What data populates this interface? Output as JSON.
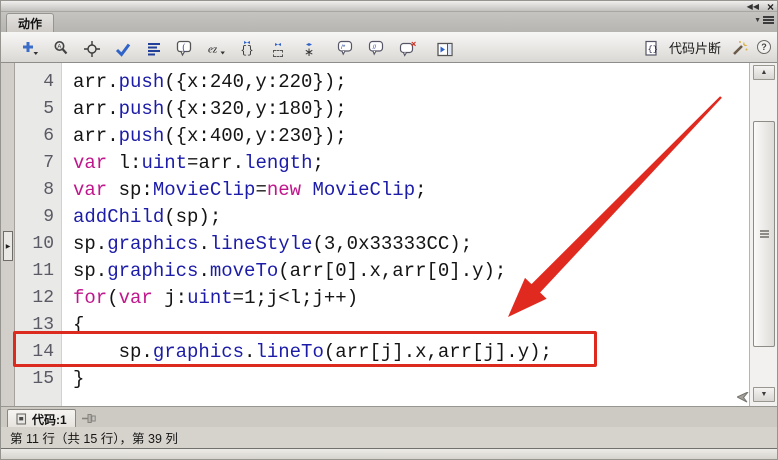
{
  "panel": {
    "title": "动作"
  },
  "toolbar": {
    "snippets_label": "代码片断",
    "icons": [
      "add-new-item",
      "find",
      "insert-target-path",
      "check-syntax",
      "auto-format",
      "show-code-hint",
      "debug-options",
      "collapse-between-braces",
      "collapse-selection",
      "expand-all",
      "apply-block-comment",
      "apply-line-comment",
      "remove-comment",
      "show-hide-toolbox",
      "code-snippets",
      "magic-wand",
      "help"
    ]
  },
  "code": {
    "colors": {
      "plain": "#141414",
      "method": "#1c1ca8",
      "keyword": "#c0168c"
    },
    "highlighted_line": 14,
    "lines": [
      {
        "num": 4,
        "segments": [
          {
            "t": "arr.",
            "c": "plain"
          },
          {
            "t": "push",
            "c": "method"
          },
          {
            "t": "({x:240,y:220});",
            "c": "plain"
          }
        ]
      },
      {
        "num": 5,
        "segments": [
          {
            "t": "arr.",
            "c": "plain"
          },
          {
            "t": "push",
            "c": "method"
          },
          {
            "t": "({x:320,y:180});",
            "c": "plain"
          }
        ]
      },
      {
        "num": 6,
        "segments": [
          {
            "t": "arr.",
            "c": "plain"
          },
          {
            "t": "push",
            "c": "method"
          },
          {
            "t": "({x:400,y:230});",
            "c": "plain"
          }
        ]
      },
      {
        "num": 7,
        "segments": [
          {
            "t": "var",
            "c": "keyword"
          },
          {
            "t": " l:",
            "c": "plain"
          },
          {
            "t": "uint",
            "c": "method"
          },
          {
            "t": "=arr.",
            "c": "plain"
          },
          {
            "t": "length",
            "c": "method"
          },
          {
            "t": ";",
            "c": "plain"
          }
        ]
      },
      {
        "num": 8,
        "segments": [
          {
            "t": "var",
            "c": "keyword"
          },
          {
            "t": " sp:",
            "c": "plain"
          },
          {
            "t": "MovieClip",
            "c": "method"
          },
          {
            "t": "=",
            "c": "plain"
          },
          {
            "t": "new",
            "c": "keyword"
          },
          {
            "t": " ",
            "c": "plain"
          },
          {
            "t": "MovieClip",
            "c": "method"
          },
          {
            "t": ";",
            "c": "plain"
          }
        ]
      },
      {
        "num": 9,
        "segments": [
          {
            "t": "addChild",
            "c": "method"
          },
          {
            "t": "(sp);",
            "c": "plain"
          }
        ]
      },
      {
        "num": 10,
        "segments": [
          {
            "t": "sp.",
            "c": "plain"
          },
          {
            "t": "graphics",
            "c": "method"
          },
          {
            "t": ".",
            "c": "plain"
          },
          {
            "t": "lineStyle",
            "c": "method"
          },
          {
            "t": "(3,0x33333CC);",
            "c": "plain"
          }
        ]
      },
      {
        "num": 11,
        "segments": [
          {
            "t": "sp.",
            "c": "plain"
          },
          {
            "t": "graphics",
            "c": "method"
          },
          {
            "t": ".",
            "c": "plain"
          },
          {
            "t": "moveTo",
            "c": "method"
          },
          {
            "t": "(arr[0].x,arr[0].y);",
            "c": "plain"
          }
        ]
      },
      {
        "num": 12,
        "segments": [
          {
            "t": "for",
            "c": "keyword"
          },
          {
            "t": "(",
            "c": "plain"
          },
          {
            "t": "var",
            "c": "keyword"
          },
          {
            "t": " j:",
            "c": "plain"
          },
          {
            "t": "uint",
            "c": "method"
          },
          {
            "t": "=1;j<l;j++)",
            "c": "plain"
          }
        ]
      },
      {
        "num": 13,
        "segments": [
          {
            "t": "{",
            "c": "plain"
          }
        ]
      },
      {
        "num": 14,
        "segments": [
          {
            "t": "    sp.",
            "c": "plain"
          },
          {
            "t": "graphics",
            "c": "method"
          },
          {
            "t": ".",
            "c": "plain"
          },
          {
            "t": "lineTo",
            "c": "method"
          },
          {
            "t": "(arr[j].x,arr[j].y);",
            "c": "plain"
          }
        ]
      },
      {
        "num": 15,
        "segments": [
          {
            "t": "}",
            "c": "plain"
          }
        ]
      }
    ]
  },
  "bottom": {
    "tab_label": "代码:1",
    "status": "第 11 行（共 15 行），第 39 列"
  },
  "annotations": {
    "arrow_color": "#e02a1f",
    "box_color": "#dc2a1e"
  }
}
